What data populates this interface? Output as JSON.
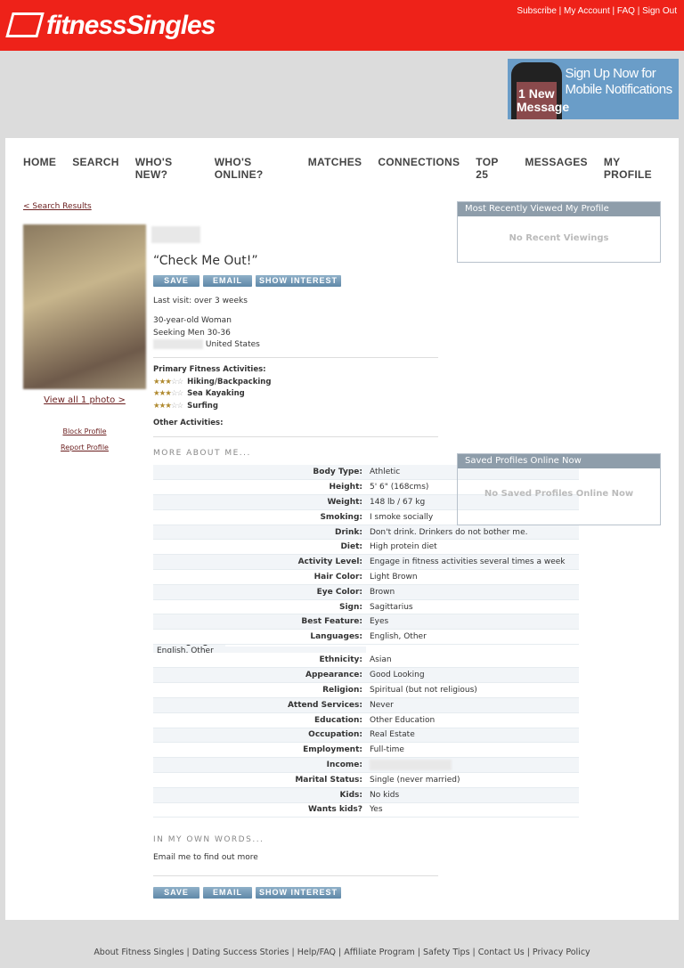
{
  "header": {
    "logo": "fitnessSingles",
    "top_links": [
      "Subscribe",
      "My Account",
      "FAQ",
      "Sign Out"
    ]
  },
  "banner": {
    "phone_text": "1 New Message",
    "text": "Sign Up Now for Mobile Notifications"
  },
  "nav": [
    "HOME",
    "SEARCH",
    "WHO'S NEW?",
    "WHO'S ONLINE?",
    "MATCHES",
    "CONNECTIONS",
    "TOP 25",
    "MESSAGES",
    "MY PROFILE"
  ],
  "profile": {
    "back_link": "< Search Results",
    "view_photos": "View all 1 photo >",
    "block": "Block Profile",
    "report": "Report Profile",
    "headline": "“Check Me Out!”",
    "buttons": {
      "save": "SAVE",
      "email": "EMAIL",
      "interest": "SHOW INTEREST"
    },
    "last_visit": "Last visit: over 3 weeks",
    "age_gender": "30-year-old Woman",
    "seeking": "Seeking Men 30-36",
    "country": "United States",
    "primary_label": "Primary Fitness Activities:",
    "activities": [
      {
        "name": "Hiking/Backpacking",
        "rating": 3
      },
      {
        "name": "Sea Kayaking",
        "rating": 3
      },
      {
        "name": "Surfing",
        "rating": 3
      }
    ],
    "other_label": "Other Activities:",
    "more_heading": "MORE ABOUT ME...",
    "details": [
      [
        "Body Type:",
        "Athletic"
      ],
      [
        "Height:",
        "5' 6\" (168cms)"
      ],
      [
        "Weight:",
        "148 lb / 67 kg"
      ],
      [
        "Smoking:",
        "I smoke socially"
      ],
      [
        "Drink:",
        "Don't drink. Drinkers do not bother me."
      ],
      [
        "Diet:",
        "High protein diet"
      ],
      [
        "Activity Level:",
        "Engage in fitness activities several times a week"
      ],
      [
        "Hair Color:",
        "Light Brown"
      ],
      [
        "Eye Color:",
        "Brown"
      ],
      [
        "Sign:",
        "Sagittarius"
      ],
      [
        "Best Feature:",
        "Eyes"
      ],
      [
        "Languages:",
        "English, Other"
      ],
      [
        "Languages:",
        "English, Other"
      ],
      [
        "Ethnicity:",
        "Asian"
      ],
      [
        "Appearance:",
        "Good Looking"
      ],
      [
        "Religion:",
        "Spiritual (but not religious)"
      ],
      [
        "Attend Services:",
        "Never"
      ],
      [
        "Education:",
        "Other Education"
      ],
      [
        "Occupation:",
        "Real Estate"
      ],
      [
        "Employment:",
        "Full-time"
      ],
      [
        "Income:",
        ""
      ],
      [
        "Marital Status:",
        "Single (never married)"
      ],
      [
        "Kids:",
        "No kids"
      ],
      [
        "Wants kids?",
        "Yes"
      ]
    ],
    "own_words_heading": "IN MY OWN WORDS...",
    "own_words": "Email me to find out more"
  },
  "sidebar": {
    "recent_title": "Most Recently Viewed My Profile",
    "recent_empty": "No Recent Viewings",
    "saved_title": "Saved Profiles Online Now",
    "saved_empty": "No Saved Profiles Online Now"
  },
  "footer": [
    "About Fitness Singles",
    "Dating Success Stories",
    "Help/FAQ",
    "Affiliate Program",
    "Safety Tips",
    "Contact Us",
    "Privacy Policy"
  ]
}
